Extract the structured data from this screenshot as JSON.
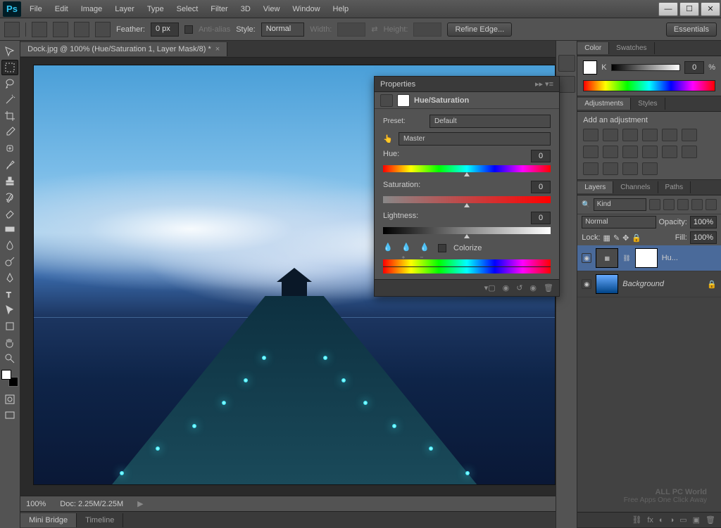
{
  "menubar": [
    "File",
    "Edit",
    "Image",
    "Layer",
    "Type",
    "Select",
    "Filter",
    "3D",
    "View",
    "Window",
    "Help"
  ],
  "options": {
    "feather_label": "Feather:",
    "feather_value": "0 px",
    "antialias": "Anti-alias",
    "style_label": "Style:",
    "style_value": "Normal",
    "width_label": "Width:",
    "height_label": "Height:",
    "refine": "Refine Edge...",
    "essentials": "Essentials"
  },
  "doctab": {
    "title": "Dock.jpg @ 100% (Hue/Saturation 1, Layer Mask/8) *",
    "close": "×"
  },
  "statusbar": {
    "zoom": "100%",
    "doc": "Doc: 2.25M/2.25M"
  },
  "bottomtabs": [
    "Mini Bridge",
    "Timeline"
  ],
  "color_panel": {
    "tabs": [
      "Color",
      "Swatches"
    ],
    "k_label": "K",
    "k_value": "0",
    "pct": "%"
  },
  "adjustments_panel": {
    "tabs": [
      "Adjustments",
      "Styles"
    ],
    "label": "Add an adjustment"
  },
  "layers_panel": {
    "tabs": [
      "Layers",
      "Channels",
      "Paths"
    ],
    "kind": "Kind",
    "blend": "Normal",
    "opacity_label": "Opacity:",
    "opacity_value": "100%",
    "lock_label": "Lock:",
    "fill_label": "Fill:",
    "fill_value": "100%",
    "layers": [
      {
        "name": "Hu..."
      },
      {
        "name": "Background"
      }
    ]
  },
  "properties": {
    "header": "Properties",
    "title": "Hue/Saturation",
    "preset_label": "Preset:",
    "preset_value": "Default",
    "channel_value": "Master",
    "hue_label": "Hue:",
    "hue_value": "0",
    "sat_label": "Saturation:",
    "sat_value": "0",
    "light_label": "Lightness:",
    "light_value": "0",
    "colorize": "Colorize"
  },
  "watermark": {
    "main": "ALL PC World",
    "sub": "Free Apps One Click Away"
  }
}
